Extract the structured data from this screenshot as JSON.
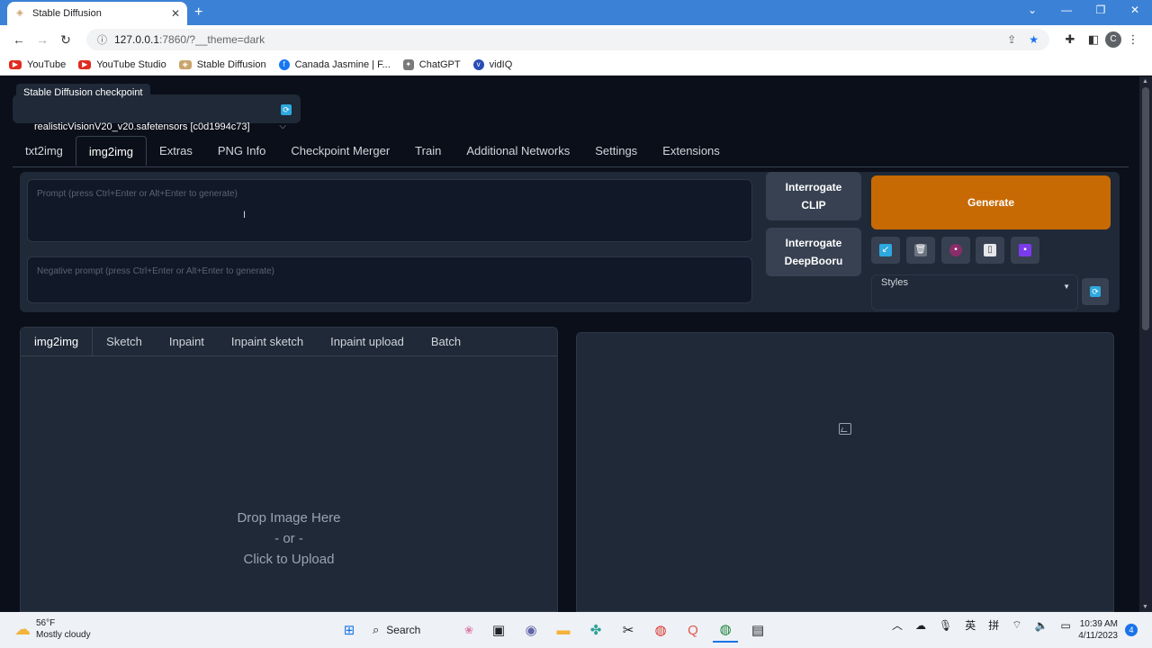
{
  "browser": {
    "tab_title": "Stable Diffusion",
    "tab_close": "✕",
    "new_tab": "+",
    "window_controls": [
      "⌄",
      "—",
      "❐",
      "✕"
    ],
    "url_host": "127.0.0.1",
    "url_rest": ":7860/?__theme=dark",
    "profile_initial": "C",
    "bookmarks": [
      {
        "label": "YouTube",
        "color": "#e02b20"
      },
      {
        "label": "YouTube Studio",
        "color": "#e02b20"
      },
      {
        "label": "Stable Diffusion",
        "color": "#c9a46b"
      },
      {
        "label": "Canada Jasmine | F...",
        "color": "#1877f2"
      },
      {
        "label": "ChatGPT",
        "color": "#7a7a7a"
      },
      {
        "label": "vidIQ",
        "color": "#2b4db8"
      }
    ]
  },
  "app": {
    "checkpoint_label": "Stable Diffusion checkpoint",
    "checkpoint_value": "realisticVisionV20_v20.safetensors [c0d1994c73]",
    "main_tabs": [
      "txt2img",
      "img2img",
      "Extras",
      "PNG Info",
      "Checkpoint Merger",
      "Train",
      "Additional Networks",
      "Settings",
      "Extensions"
    ],
    "active_tab": "img2img",
    "prompt_placeholder": "Prompt (press Ctrl+Enter or Alt+Enter to generate)",
    "negative_placeholder": "Negative prompt (press Ctrl+Enter or Alt+Enter to generate)",
    "interrogate_clip_line1": "Interrogate",
    "interrogate_clip_line2": "CLIP",
    "interrogate_deep_line1": "Interrogate",
    "interrogate_deep_line2": "DeepBooru",
    "generate_label": "Generate",
    "styles_label": "Styles",
    "sub_tabs": [
      "img2img",
      "Sketch",
      "Inpaint",
      "Inpaint sketch",
      "Inpaint upload",
      "Batch"
    ],
    "drop_line1": "Drop Image Here",
    "drop_line2": "- or -",
    "drop_line3": "Click to Upload",
    "accent_color": "#c76a04"
  },
  "taskbar": {
    "temperature": "56°F",
    "weather": "Mostly cloudy",
    "search_label": "Search",
    "lang1": "英",
    "lang2": "拼",
    "time": "10:39 AM",
    "date": "4/11/2023",
    "notifications": "4"
  }
}
